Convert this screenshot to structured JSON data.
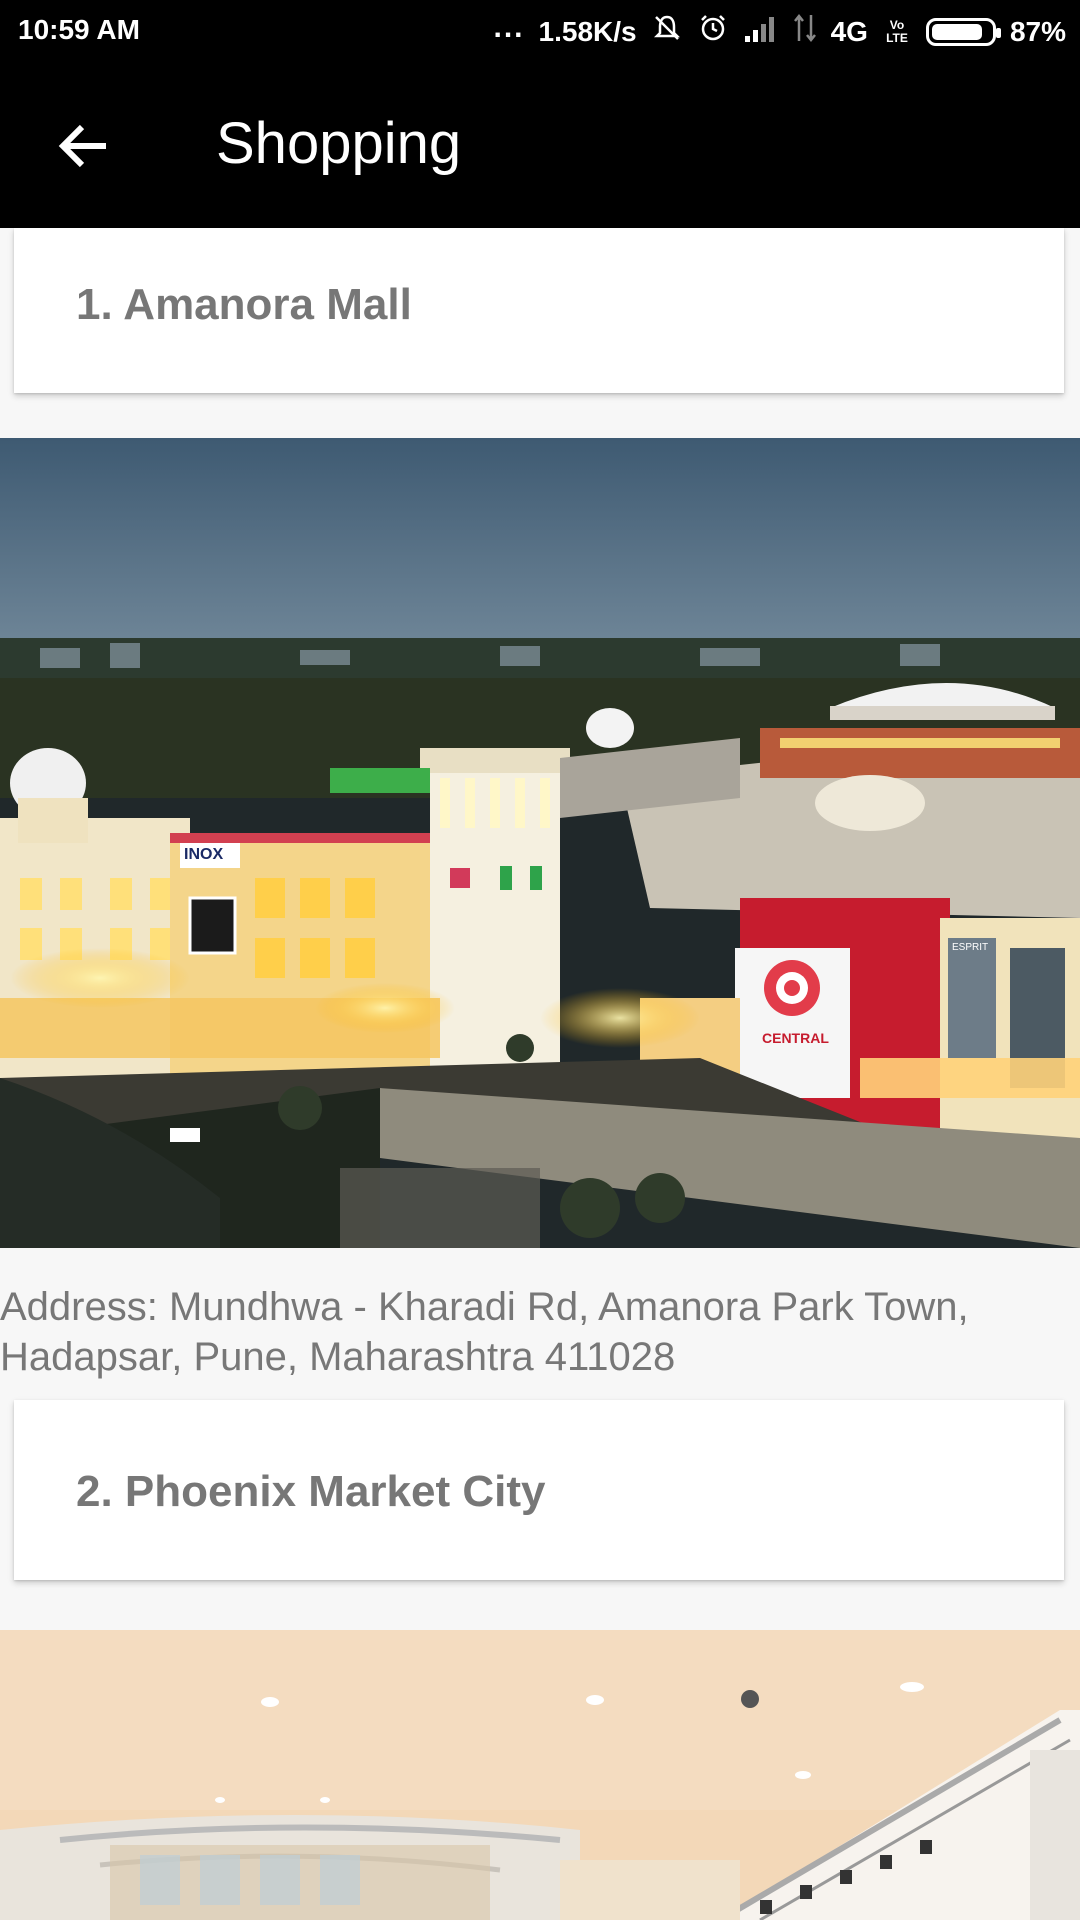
{
  "status_bar": {
    "time": "10:59 AM",
    "dots": "...",
    "speed": "1.58K/s",
    "network": "4G",
    "volte": "Vo LTE",
    "battery": "87%",
    "battery_level": 0.87,
    "icons": [
      "vibrate-off-icon",
      "alarm-icon",
      "signal-icon",
      "data-icon",
      "battery-icon"
    ]
  },
  "app_bar": {
    "title": "Shopping",
    "back_icon": "arrow-back-icon"
  },
  "places": [
    {
      "heading": "1. Amanora Mall",
      "address": "Address: Mundhwa - Kharadi Rd, Amanora Park Town, Hadapsar, Pune, Maharashtra 411028"
    },
    {
      "heading": "2. Phoenix Market City"
    }
  ],
  "photo_signs": {
    "inox": "INOX",
    "central": "CENTRAL",
    "esprit": "ESPRIT"
  },
  "colors": {
    "bar_bg": "#000000",
    "page_bg": "#f7f7f7",
    "heading_text": "#777777"
  }
}
